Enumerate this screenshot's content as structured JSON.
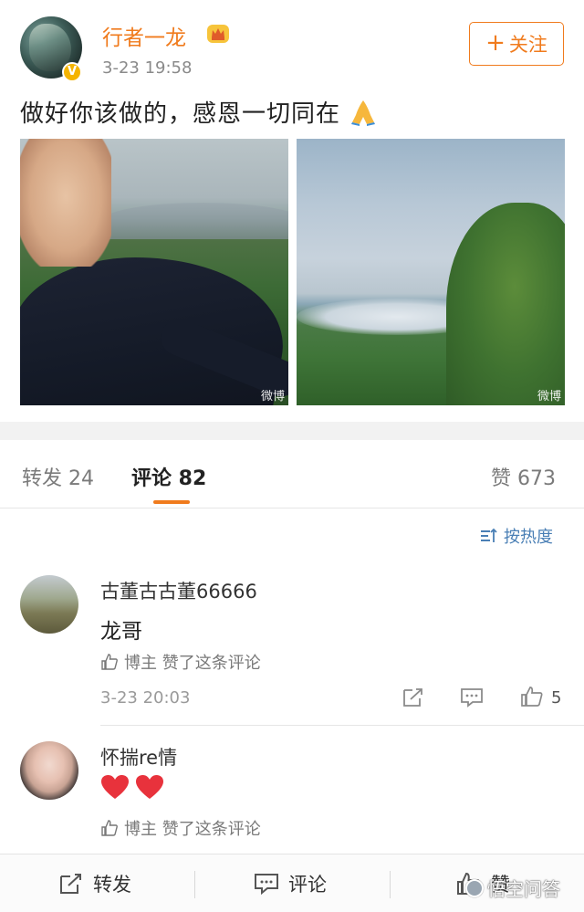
{
  "post": {
    "author": "行者一龙",
    "time": "3-23 19:58",
    "follow_label": "关注",
    "follow_plus": "+",
    "text": "做好你该做的，感恩一切同在",
    "photo_watermark": "微博"
  },
  "tabs": {
    "repost": "转发 24",
    "comments": "评论 82",
    "likes": "赞 673"
  },
  "sort": {
    "label": "按热度"
  },
  "comments": [
    {
      "name": "古董古古董66666",
      "text": "龙哥",
      "meta": "博主 赞了这条评论",
      "time": "3-23 20:03",
      "likes": "5"
    },
    {
      "name": "怀揣re情",
      "meta": "博主 赞了这条评论"
    }
  ],
  "bottom_bar": {
    "repost": "转发",
    "comment": "评论",
    "like": "赞"
  },
  "site_watermark": "悟空问答",
  "colors": {
    "accent": "#f07b1d",
    "link": "#4a7fb5",
    "heart": "#e8323c"
  }
}
